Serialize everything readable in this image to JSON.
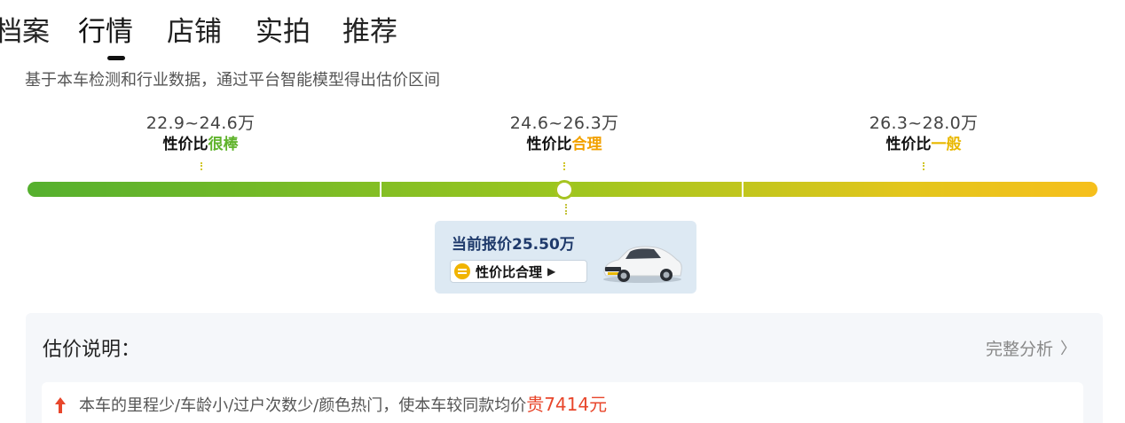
{
  "tabs": [
    {
      "label": "档案"
    },
    {
      "label": "行情",
      "active": true
    },
    {
      "label": "店铺"
    },
    {
      "label": "实拍"
    },
    {
      "label": "推荐"
    }
  ],
  "subtitle": "基于本车检测和行业数据，通过平台智能模型得出估价区间",
  "ranges": [
    {
      "value": "22.9~24.6万",
      "label_prefix": "性价比",
      "label_highlight": "很棒",
      "highlight_color": "#5fb32b"
    },
    {
      "value": "24.6~26.3万",
      "label_prefix": "性价比",
      "label_highlight": "合理",
      "highlight_color": "#f2a100"
    },
    {
      "value": "26.3~28.0万",
      "label_prefix": "性价比",
      "label_highlight": "一般",
      "highlight_color": "#e9b800"
    }
  ],
  "current_price": {
    "text": "当前报价25.50万",
    "badge": "性价比合理",
    "position_fraction": 0.5
  },
  "explanation": {
    "title": "估价说明：",
    "full_analysis_label": "完整分析",
    "item_text": "本车的里程少/车龄小/过户次数少/颜色热门，使本车较同款均价",
    "item_accent": "贵7414元"
  },
  "colors": {
    "good": "#5fb32b",
    "fair": "#f2a100",
    "average": "#e9b800",
    "accent_red": "#e8462b",
    "price_text": "#1f3a6b"
  }
}
